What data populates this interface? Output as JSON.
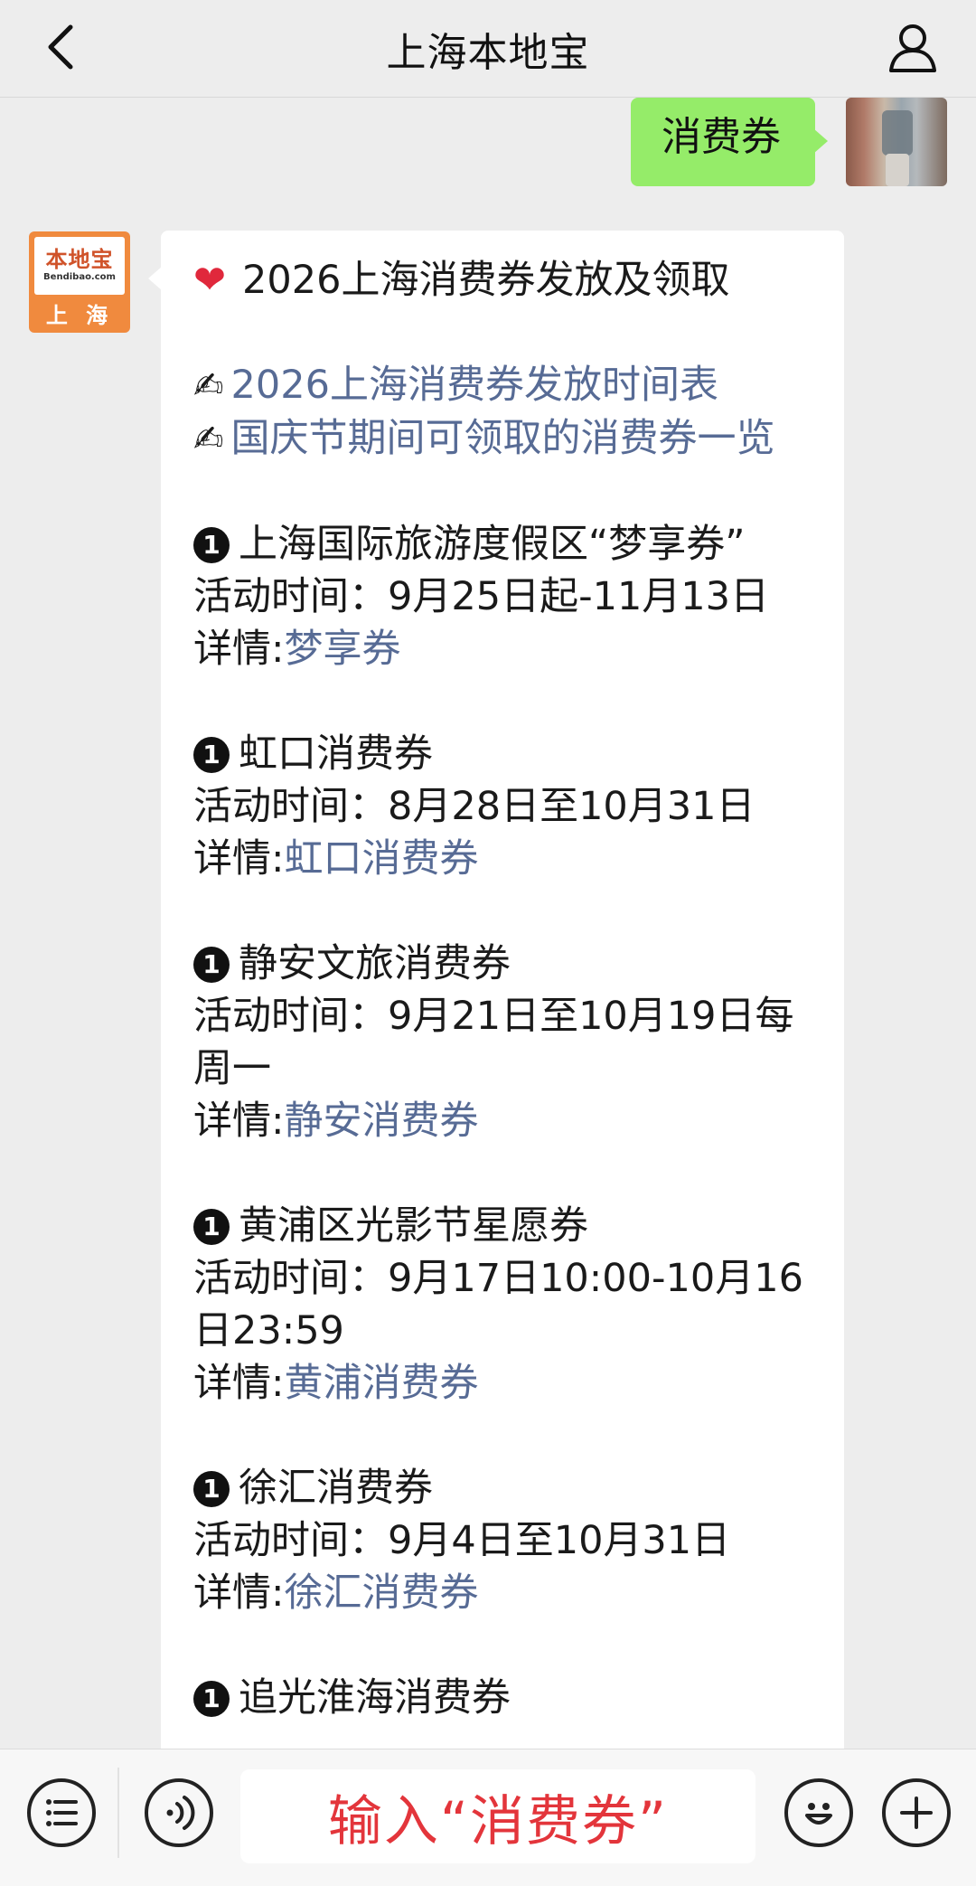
{
  "header": {
    "title": "上海本地宝"
  },
  "sent_message": {
    "text": "消费券"
  },
  "received_avatar": {
    "brand": "本地宝",
    "domain": "Bendibao.com",
    "city": "上 海"
  },
  "message": {
    "heart_icon": "❤",
    "title": "2026上海消费券发放及领取",
    "pen_icon": "✍",
    "links": [
      "2026上海消费券发放时间表",
      "国庆节期间可领取的消费券一览"
    ],
    "time_label": "活动时间：",
    "detail_label": "详情:",
    "marker": "1",
    "items": [
      {
        "name": "上海国际旅游度假区“梦享券”",
        "time": "9月25日起-11月13日",
        "link": "梦享券"
      },
      {
        "name": "虹口消费券",
        "time": "8月28日至10月31日",
        "link": "虹口消费券"
      },
      {
        "name": "静安文旅消费券",
        "time": "9月21日至10月19日每周一",
        "link": "静安消费券"
      },
      {
        "name": "黄浦区光影节星愿券",
        "time": "9月17日10:00-10月16日23:59",
        "link": "黄浦消费券"
      },
      {
        "name": "徐汇消费券",
        "time": "9月4日至10月31日",
        "link": "徐汇消费券"
      },
      {
        "name": "追光淮海消费券"
      }
    ]
  },
  "bottom_bar": {
    "input_text": "输入“消费券”"
  }
}
